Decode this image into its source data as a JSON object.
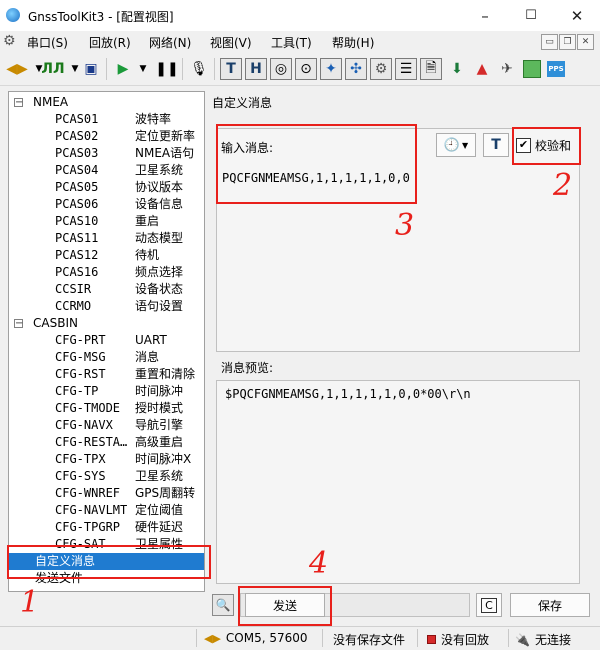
{
  "window": {
    "title": "GnssToolKit3 - [配置视图]",
    "controls": {
      "minimize": "–",
      "maximize": "☐",
      "close": "✕"
    }
  },
  "menu": {
    "items": [
      "串口(S)",
      "回放(R)",
      "网络(N)",
      "视图(V)",
      "工具(T)",
      "帮助(H)"
    ]
  },
  "toolbar": {
    "icons": [
      "connect-icon",
      "waveform-icon",
      "save-icon",
      "play-icon",
      "pause-icon",
      "mic-icon",
      "text-view-icon",
      "hex-view-icon",
      "compass-icon",
      "target-icon",
      "satellite-icon",
      "grid-icon",
      "gear-icon",
      "list-icon",
      "doc-icon",
      "download-icon",
      "nav-arrow-icon",
      "sat-alt-icon",
      "green-box-icon",
      "pps-icon"
    ],
    "labels": {
      "text": "T",
      "hex": "H",
      "pps": "PPS"
    }
  },
  "tree": {
    "groups": [
      {
        "label": "NMEA",
        "items": [
          {
            "cmd": "PCAS01",
            "desc": "波特率"
          },
          {
            "cmd": "PCAS02",
            "desc": "定位更新率"
          },
          {
            "cmd": "PCAS03",
            "desc": "NMEA语句"
          },
          {
            "cmd": "PCAS04",
            "desc": "卫星系统"
          },
          {
            "cmd": "PCAS05",
            "desc": "协议版本"
          },
          {
            "cmd": "PCAS06",
            "desc": "设备信息"
          },
          {
            "cmd": "PCAS10",
            "desc": "重启"
          },
          {
            "cmd": "PCAS11",
            "desc": "动态模型"
          },
          {
            "cmd": "PCAS12",
            "desc": "待机"
          },
          {
            "cmd": "PCAS16",
            "desc": "频点选择"
          },
          {
            "cmd": "CCSIR",
            "desc": "设备状态"
          },
          {
            "cmd": "CCRMO",
            "desc": "语句设置"
          }
        ]
      },
      {
        "label": "CASBIN",
        "items": [
          {
            "cmd": "CFG-PRT",
            "desc": "UART"
          },
          {
            "cmd": "CFG-MSG",
            "desc": "消息"
          },
          {
            "cmd": "CFG-RST",
            "desc": "重置和清除"
          },
          {
            "cmd": "CFG-TP",
            "desc": "时间脉冲"
          },
          {
            "cmd": "CFG-TMODE",
            "desc": "授时模式"
          },
          {
            "cmd": "CFG-NAVX",
            "desc": "导航引擎"
          },
          {
            "cmd": "CFG-RESTA…",
            "desc": "高级重启"
          },
          {
            "cmd": "CFG-TPX",
            "desc": "时间脉冲X"
          },
          {
            "cmd": "CFG-SYS",
            "desc": "卫星系统"
          },
          {
            "cmd": "CFG-WNREF",
            "desc": "GPS周翻转"
          },
          {
            "cmd": "CFG-NAVLMT",
            "desc": "定位阈值"
          },
          {
            "cmd": "CFG-TPGRP",
            "desc": "硬件延迟"
          },
          {
            "cmd": "CFG-SAT",
            "desc": "卫星属性"
          }
        ]
      }
    ],
    "extra": [
      {
        "label": "自定义消息",
        "selected": true
      },
      {
        "label": "发送文件",
        "selected": false
      }
    ],
    "selected_color": "#1f7bd0"
  },
  "panel": {
    "title": "自定义消息",
    "input_label": "输入消息:",
    "input_value": "PQCFGNMEAMSG,1,1,1,1,1,0,0",
    "t_button": "T",
    "checksum_label": "校验和",
    "checksum_checked": true,
    "checkmark": "✔",
    "preview_label": "消息预览:",
    "preview_text": "$PQCFGNMEAMSG,1,1,1,1,1,0,0*00\\r\\n"
  },
  "actions": {
    "send": "发送",
    "c_button": "C",
    "save": "保存"
  },
  "status": {
    "port": "COM5, 57600",
    "save_state": "没有保存文件",
    "replay_state": "没有回放",
    "connection": "无连接"
  },
  "annotations": {
    "labels": [
      "1",
      "2",
      "3",
      "4"
    ],
    "color": "#e8201b"
  }
}
